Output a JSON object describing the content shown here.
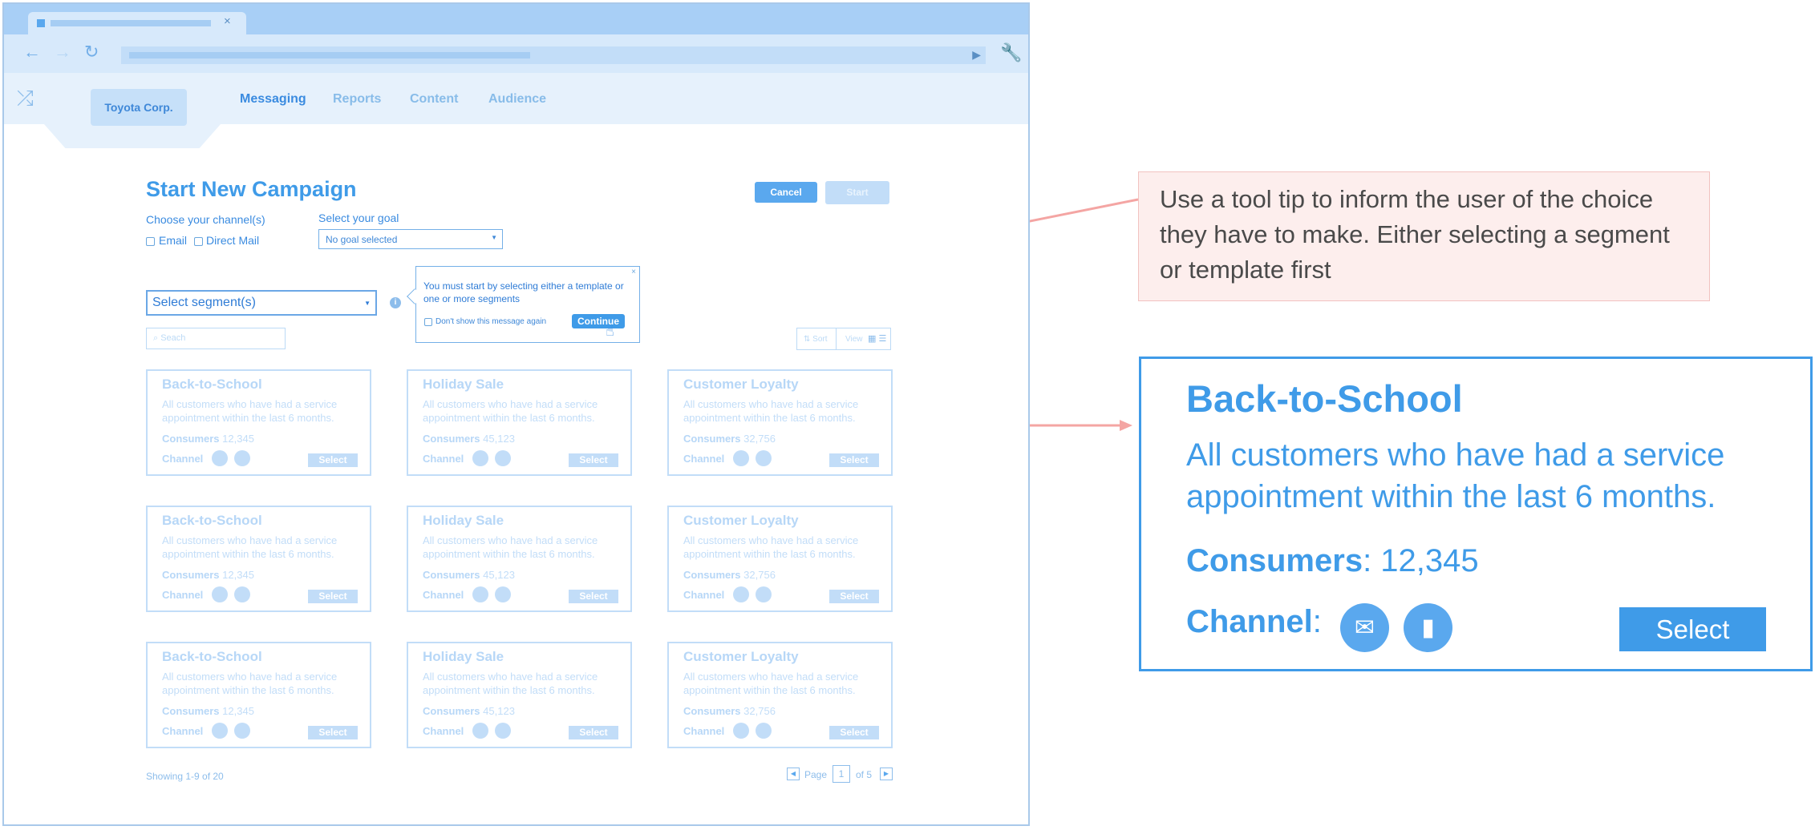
{
  "browser": {
    "tab_close": "×",
    "icons": {
      "back": "←",
      "forward": "→",
      "reload": "↻",
      "play": "▶",
      "wrench": "🔧",
      "shuffle": "⤮"
    }
  },
  "app": {
    "org": "Toyota Corp.",
    "nav": [
      "Messaging",
      "Reports",
      "Content",
      "Audience"
    ]
  },
  "campaign": {
    "title": "Start New Campaign",
    "cancel": "Cancel",
    "start": "Start",
    "channels_label": "Choose your channel(s)",
    "channel_email": "Email",
    "channel_mail": "Direct Mail",
    "goal_label": "Select your goal",
    "goal_value": "No goal selected",
    "segment_placeholder": "Select segment(s)",
    "search_placeholder": "Seach",
    "sort_label": "Sort",
    "view_label": "View",
    "showing": "Showing 1-9 of 20",
    "page_label": "Page",
    "page_current": "1",
    "page_total": "of 5"
  },
  "tooltip": {
    "text": "You must start by selecting either a template or one or more segments",
    "dont_show": "Don't show this message again",
    "continue": "Continue",
    "close": "×"
  },
  "cards": [
    {
      "title": "Back-to-School",
      "desc": "All customers who have had a service appointment within the last 6 months.",
      "cons_label": "Consumers",
      "cons_value": "12,345",
      "channel_label": "Channel",
      "select": "Select"
    },
    {
      "title": "Holiday Sale",
      "desc": "All customers who have had a service appointment within the last 6 months.",
      "cons_label": "Consumers",
      "cons_value": "45,123",
      "channel_label": "Channel",
      "select": "Select"
    },
    {
      "title": "Customer Loyalty",
      "desc": "All customers who have had a service appointment within the last 6 months.",
      "cons_label": "Consumers",
      "cons_value": "32,756",
      "channel_label": "Channel",
      "select": "Select"
    },
    {
      "title": "Back-to-School",
      "desc": "All customers who have had a service appointment within the last 6 months.",
      "cons_label": "Consumers",
      "cons_value": "12,345",
      "channel_label": "Channel",
      "select": "Select"
    },
    {
      "title": "Holiday Sale",
      "desc": "All customers who have had a service appointment within the last 6 months.",
      "cons_label": "Consumers",
      "cons_value": "45,123",
      "channel_label": "Channel",
      "select": "Select"
    },
    {
      "title": "Customer Loyalty",
      "desc": "All customers who have had a service appointment within the last 6 months.",
      "cons_label": "Consumers",
      "cons_value": "32,756",
      "channel_label": "Channel",
      "select": "Select"
    },
    {
      "title": "Back-to-School",
      "desc": "All customers who have had a service appointment within the last 6 months.",
      "cons_label": "Consumers",
      "cons_value": "12,345",
      "channel_label": "Channel",
      "select": "Select"
    },
    {
      "title": "Holiday Sale",
      "desc": "All customers who have had a service appointment within the last 6 months.",
      "cons_label": "Consumers",
      "cons_value": "45,123",
      "channel_label": "Channel",
      "select": "Select"
    },
    {
      "title": "Customer Loyalty",
      "desc": "All customers who have had a service appointment within the last 6 months.",
      "cons_label": "Consumers",
      "cons_value": "32,756",
      "channel_label": "Channel",
      "select": "Select"
    }
  ],
  "annotation": {
    "note": "Use a tool tip to inform the user of the choice they have to make. Either selecting a segment or template first"
  },
  "zoom": {
    "title": "Back-to-School",
    "desc": "All customers who have had a service appointment within the last 6 months.",
    "cons_label": "Consumers",
    "cons_value": ": 12,345",
    "channel_label": "Channel",
    "channel_colon": ":",
    "select": "Select"
  },
  "colors": {
    "accent": "#3f9be8",
    "note_bg": "#fdeeed",
    "arrow": "#f4a5a3"
  }
}
